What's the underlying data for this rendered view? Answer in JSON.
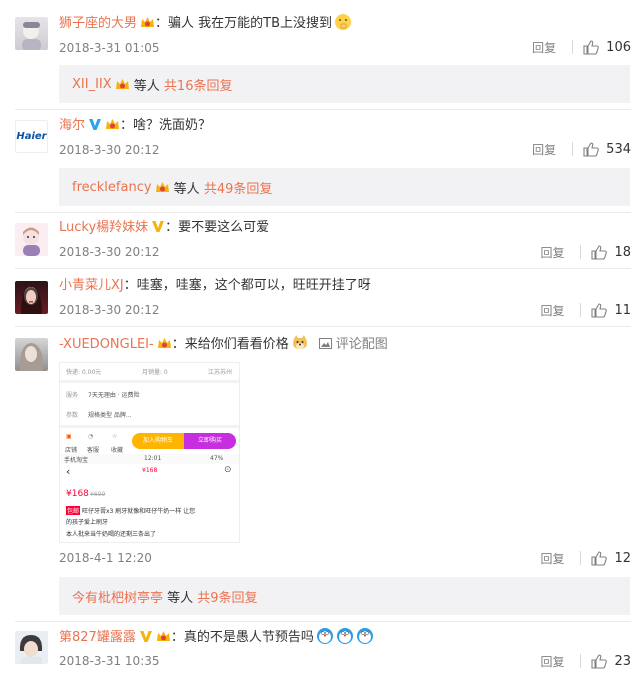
{
  "comments": [
    {
      "username": "狮子座的大男",
      "text": "：骗人 我在万能的TB上没搜到",
      "time": "2018-3-31 01:05",
      "reply_label": "回复",
      "likes": "106"
    },
    {
      "username": "海尔",
      "avatar_text": "Haier",
      "text": "：啥？洗面奶？",
      "time": "2018-3-30 20:12",
      "reply_label": "回复",
      "likes": "534"
    },
    {
      "username": "Lucky楊羚妹妹",
      "text": "：要不要这么可爱",
      "time": "2018-3-30 20:12",
      "reply_label": "回复",
      "likes": "18"
    },
    {
      "username": "小青菜儿XJ",
      "text": "：哇塞，哇塞，这个都可以，旺旺开挂了呀",
      "time": "2018-3-30 20:12",
      "reply_label": "回复",
      "likes": "11"
    },
    {
      "username": "-XUEDONGLEI-",
      "text": "：来给你们看看价格",
      "pic_link": "评论配图",
      "time": "2018-4-1 12:20",
      "reply_label": "回复",
      "likes": "12"
    },
    {
      "username": "第827罐露露",
      "text": "：真的不是愚人节预告吗",
      "time": "2018-3-31 10:35",
      "reply_label": "回复",
      "likes": "23"
    }
  ],
  "replies": [
    {
      "who": "XII_IIX",
      "etc": " 等人 ",
      "more": "共16条回复"
    },
    {
      "who": "frecklefancy",
      "etc": " 等人 ",
      "more": "共49条回复"
    },
    {
      "who": "今有枇杷树亭亭",
      "etc": " 等人 ",
      "more": "共9条回复"
    }
  ],
  "screenshot": {
    "row1_left": "快递: 0.00元",
    "row1_mid": "月销量: 0",
    "row1_right": "江苏苏州",
    "service_label": "服务",
    "service_text": "7天无理由 · 运费险",
    "param_label": "参数",
    "param_text": "规格类型 品牌...",
    "icon_shop": "店铺",
    "icon_service": "客服",
    "icon_fav": "收藏",
    "cart_btn": "加入购物车",
    "buy_btn": "立即购买",
    "status_left": "手机淘宝",
    "status_time": "12:01",
    "status_right": "47%",
    "price_small": "¥168",
    "price_big": "¥168",
    "price_orig": "¥699",
    "tag": "包邮",
    "desc1": "旺仔牙膏x3 刷牙就像和旺仔牛奶一样 让您",
    "desc2": "的孩子爱上刷牙",
    "desc3": "本人批来当牛奶喝的还剩三条出了"
  },
  "colors": {
    "accent": "#eb7350",
    "muted": "#808080",
    "reply_bg": "#f2f2f5",
    "vip_blue": "#2aa4f4",
    "vip_yellow": "#f6b30f"
  }
}
